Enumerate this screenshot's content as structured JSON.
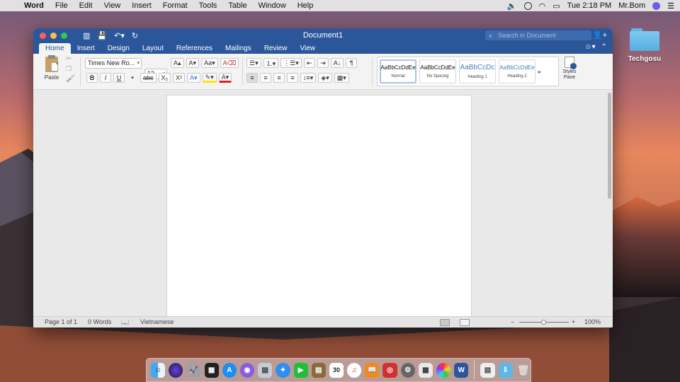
{
  "menubar": {
    "app_name": "Word",
    "menus": [
      "File",
      "Edit",
      "View",
      "Insert",
      "Format",
      "Tools",
      "Table",
      "Window",
      "Help"
    ],
    "clock": "Tue 2:18 PM",
    "user": "Mr.Bom"
  },
  "desktop": {
    "folder_label": "Techgosu"
  },
  "window": {
    "title": "Document1",
    "search_placeholder": "Search in Document",
    "tabs": [
      "Home",
      "Insert",
      "Design",
      "Layout",
      "References",
      "Mailings",
      "Review",
      "View"
    ],
    "active_tab": "Home"
  },
  "ribbon": {
    "paste_label": "Paste",
    "font_name": "Times New Ro...",
    "font_size": "12",
    "styles": [
      {
        "sample": "AaBbCcDdEe",
        "name": "Normal"
      },
      {
        "sample": "AaBbCcDdEe",
        "name": "No Spacing"
      },
      {
        "sample": "AaBbCcDc",
        "name": "Heading 1"
      },
      {
        "sample": "AaBbCcDdEe",
        "name": "Heading 2"
      }
    ],
    "styles_pane_label": "Styles\nPane"
  },
  "statusbar": {
    "page": "Page 1 of 1",
    "words": "0 Words",
    "language": "Vietnamese",
    "zoom": "100%"
  },
  "colors": {
    "word_blue": "#2b579a",
    "highlight_yellow": "#ffe600",
    "font_red": "#e02020"
  }
}
